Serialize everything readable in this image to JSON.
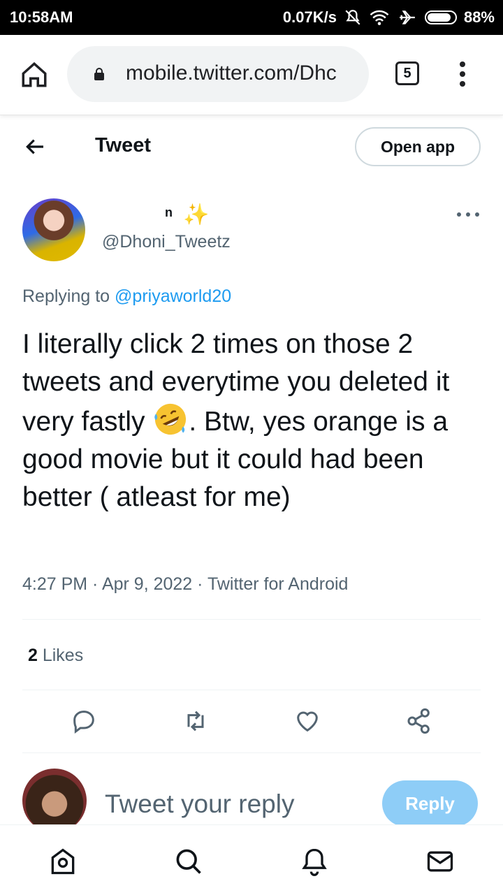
{
  "status_bar": {
    "time": "10:58AM",
    "network_speed": "0.07K/s",
    "battery": "88%",
    "battery_level": 0.88
  },
  "browser": {
    "url": "mobile.twitter.com/Dhc",
    "tab_count": "5"
  },
  "header": {
    "title": "Tweet",
    "open_app_label": "Open app"
  },
  "tweet": {
    "author_name": "n",
    "author_handle": "@Dhoni_Tweetz",
    "replying_prefix": "Replying to ",
    "replying_to": "@priyaworld20",
    "text_part1": "I literally click 2 times on those 2 tweets and everytime you deleted it very fastly ",
    "text_part2": ". Btw, yes orange is a good movie but  it could had been better ( atleast for me)",
    "meta": "4:27 PM · Apr 9, 2022 · Twitter for Android",
    "likes_count": "2",
    "likes_label": " Likes"
  },
  "reply_box": {
    "placeholder": "Tweet your reply",
    "reply_button": "Reply"
  },
  "icons": {
    "emoji": "rolling-on-floor-laughing",
    "sparkle": "sparkles"
  },
  "colors": {
    "accent": "#1d9bf0",
    "reply_button": "#8ecdf7",
    "secondary_text": "#536471"
  }
}
